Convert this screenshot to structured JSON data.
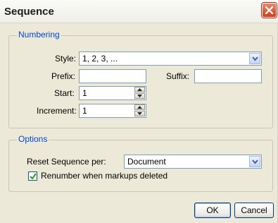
{
  "dialog": {
    "title": "Sequence",
    "close_icon": "close-icon"
  },
  "numbering": {
    "legend": "Numbering",
    "style_label": "Style:",
    "style_value": "1, 2, 3, ...",
    "prefix_label": "Prefix:",
    "prefix_value": "",
    "suffix_label": "Suffix:",
    "suffix_value": "",
    "start_label": "Start:",
    "start_value": "1",
    "increment_label": "Increment:",
    "increment_value": "1"
  },
  "options": {
    "legend": "Options",
    "reset_label": "Reset Sequence per:",
    "reset_value": "Document",
    "renumber_label": "Renumber when markups deleted",
    "renumber_checked": true
  },
  "buttons": {
    "ok": "OK",
    "cancel": "Cancel"
  },
  "colors": {
    "legend": "#0046d5",
    "close_button": "#d2502d",
    "dialog_bg": "#ece9d8"
  }
}
